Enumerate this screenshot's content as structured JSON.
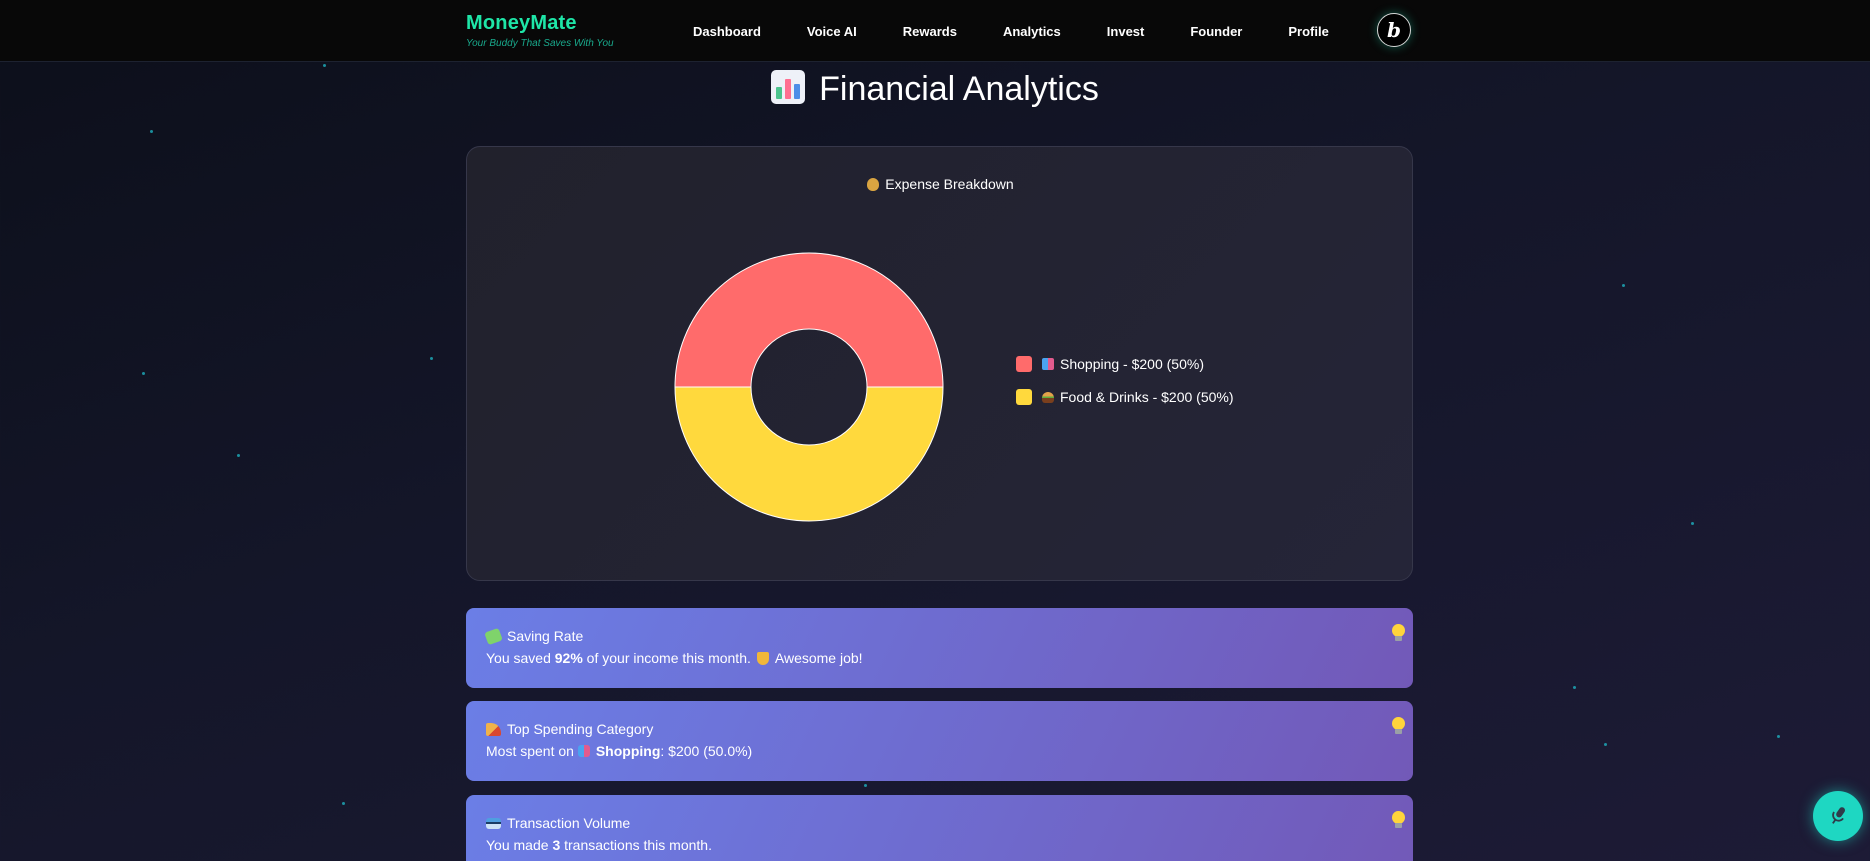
{
  "navbar": {
    "brand": "MoneyMate",
    "tagline": "Your Buddy That Saves With You",
    "links": [
      "Dashboard",
      "Voice AI",
      "Rewards",
      "Analytics",
      "Invest",
      "Founder",
      "Profile"
    ],
    "badge_letter": "b"
  },
  "page": {
    "title": "Financial Analytics",
    "title_icon": "bar-chart-icon"
  },
  "chart_card": {
    "title": "Expense Breakdown",
    "title_icon": "money-bag-icon"
  },
  "chart_data": {
    "type": "pie",
    "variant": "doughnut",
    "title": "Expense Breakdown",
    "categories": [
      "Shopping",
      "Food & Drinks"
    ],
    "values": [
      200,
      200
    ],
    "percentages": [
      50,
      50
    ],
    "colors": [
      "#ff6b6b",
      "#ffd93d"
    ],
    "legend_labels": [
      "Shopping - $200 (50%)",
      "Food & Drinks - $200 (50%)"
    ],
    "legend_icons": [
      "shopping-bags-icon",
      "hamburger-icon"
    ],
    "legend_position": "right"
  },
  "insights": [
    {
      "icon": "money-wings-icon",
      "title": "Saving Rate",
      "pre": "You saved ",
      "bold": "92%",
      "post": " of your income this month.",
      "extra_icon": "trophy-icon",
      "extra": "Awesome job!"
    },
    {
      "icon": "pizza-icon",
      "title": "Top Spending Category",
      "pre": "Most spent on ",
      "inline_icon": "shopping-bags-icon",
      "bold": "Shopping",
      "post": ": $200 (50.0%)"
    },
    {
      "icon": "credit-card-icon",
      "title": "Transaction Volume",
      "pre": "You made ",
      "bold": "3",
      "post": " transactions this month."
    }
  ],
  "colors": {
    "brand": "#1ee6a8",
    "accent": "#1ed7c2",
    "card_gradient_start": "#6b7ee6",
    "card_gradient_end": "#7259b8"
  },
  "fab_icon": "microphone-icon"
}
